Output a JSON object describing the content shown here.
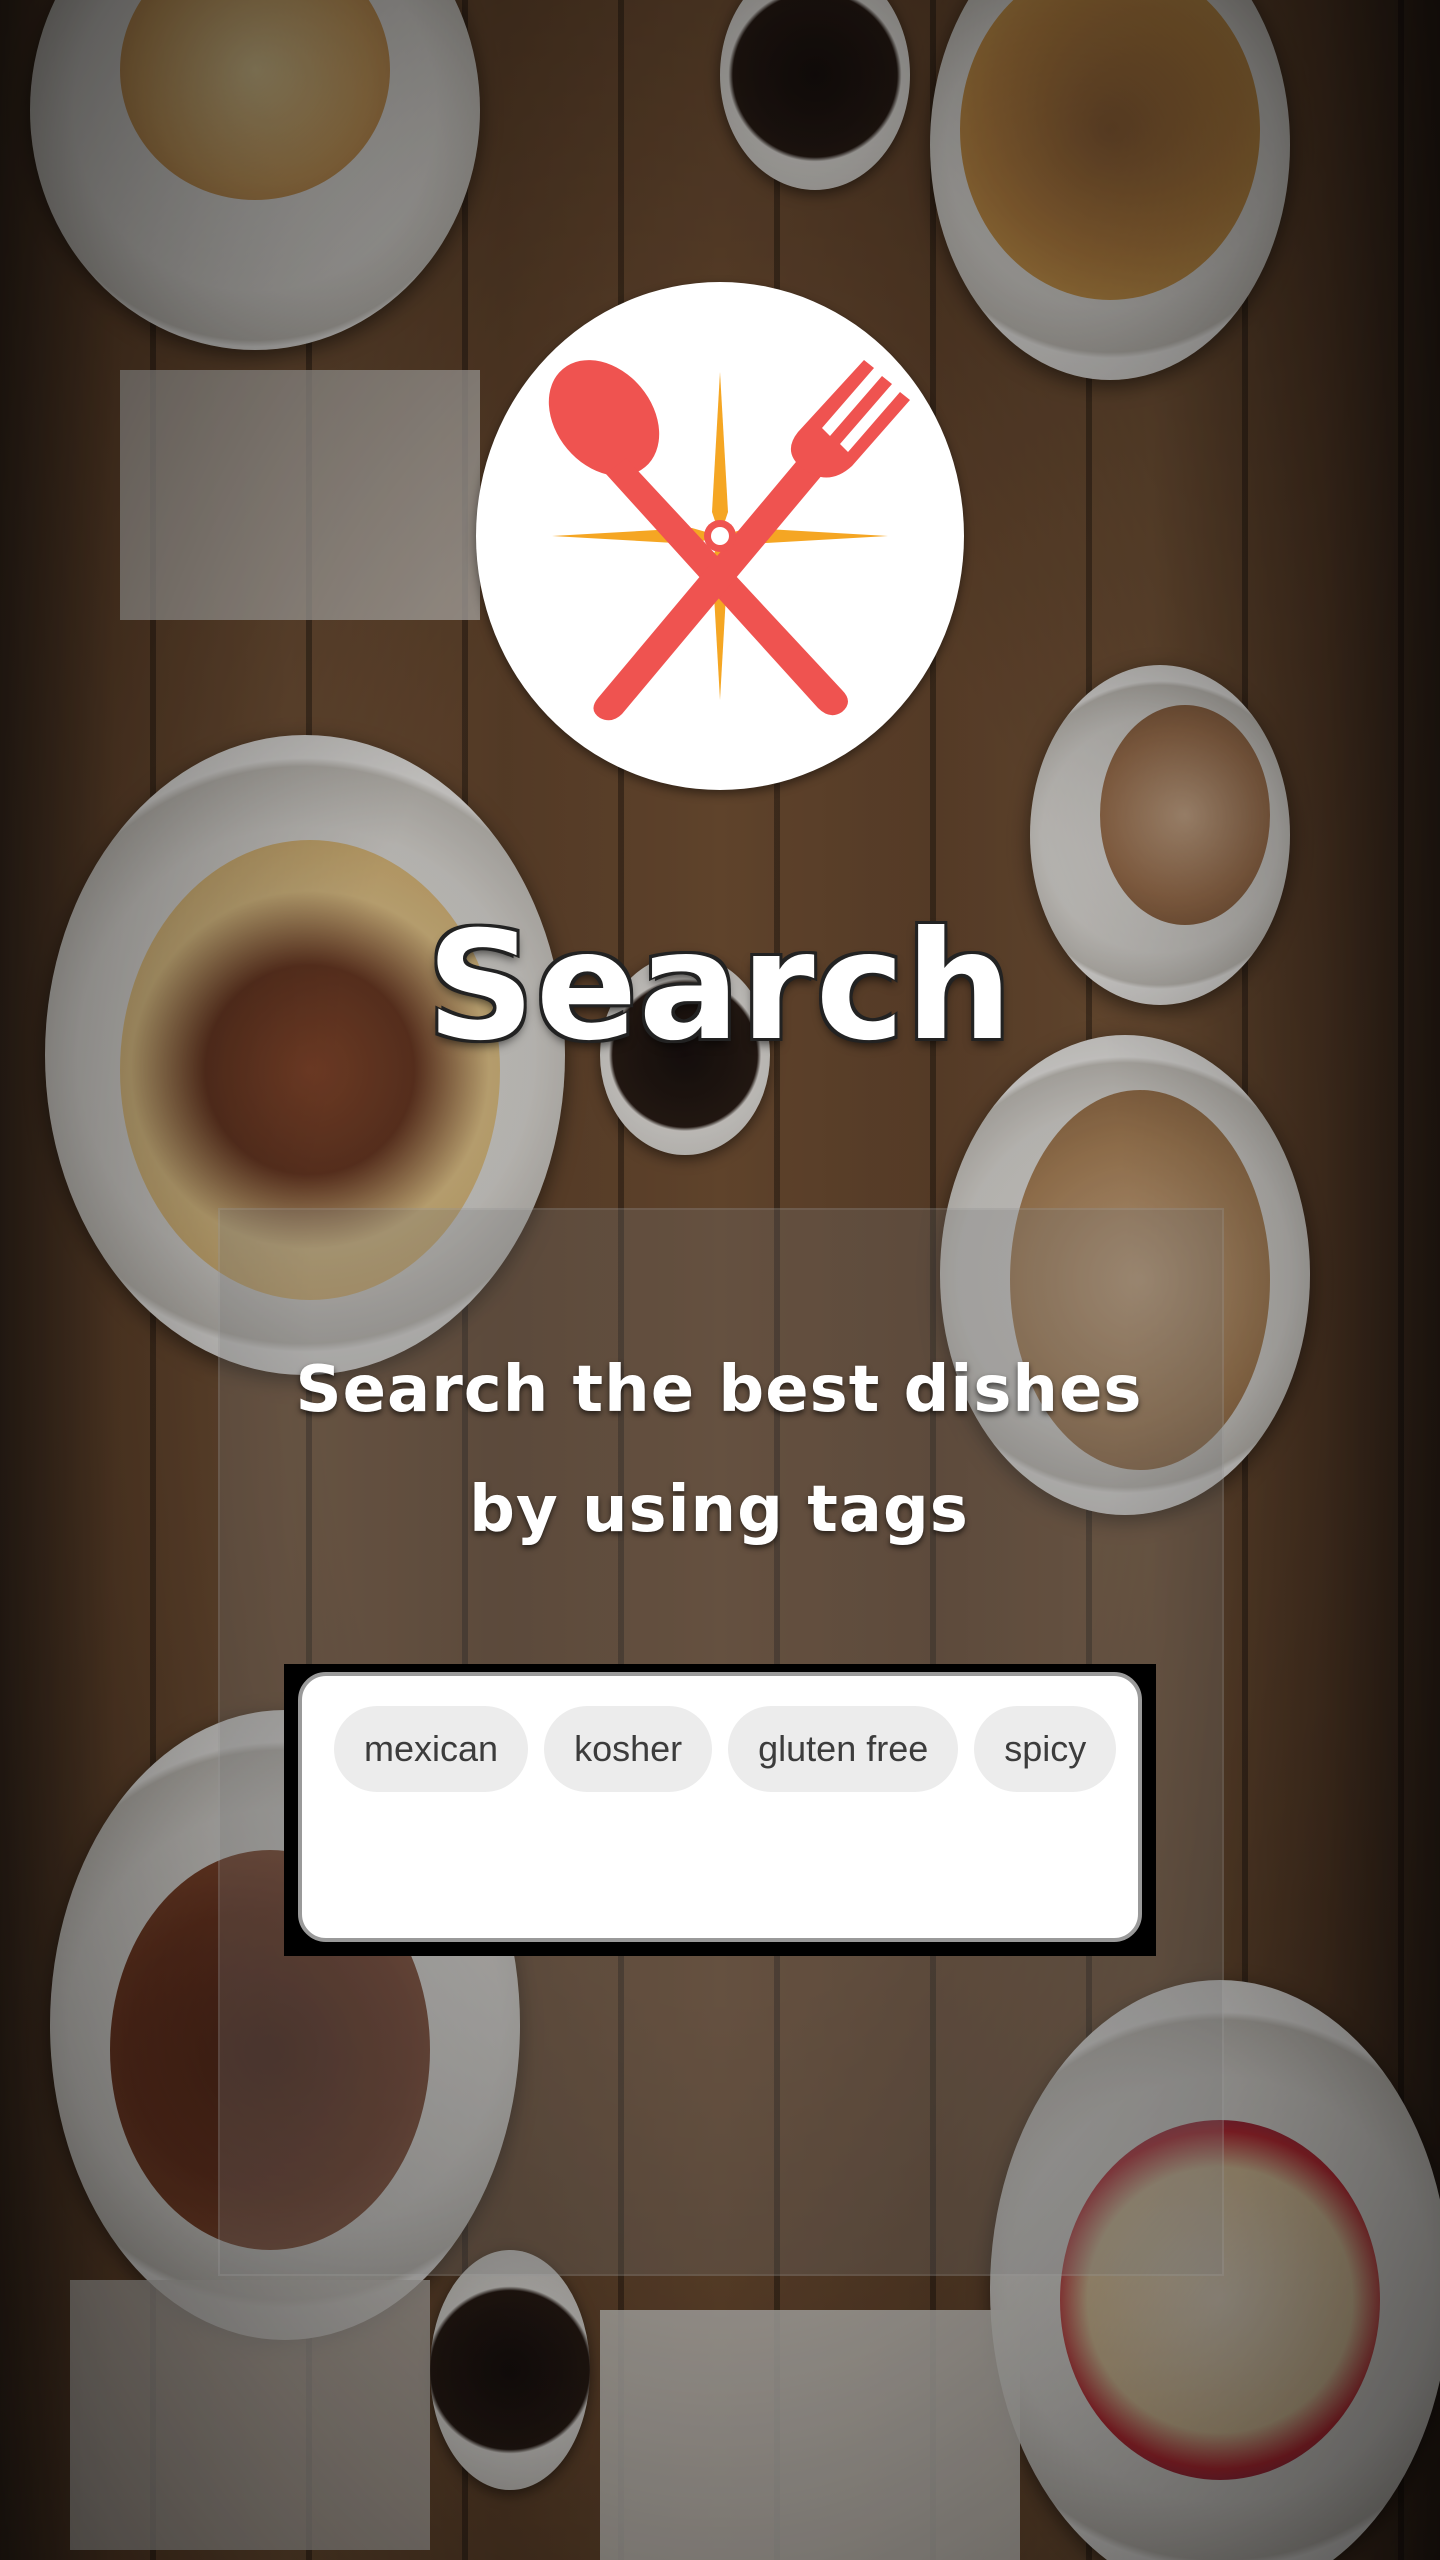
{
  "app": {
    "title": "Search",
    "subtitle_line1": "Search the best dishes",
    "subtitle_line2": "by using tags",
    "logo_icon": "crossed-spoon-fork-icon",
    "accent_color": "#ef5350",
    "star_color": "#f5a623"
  },
  "tags": {
    "items": [
      {
        "label": "mexican"
      },
      {
        "label": "kosher"
      },
      {
        "label": "gluten free"
      },
      {
        "label": "spicy"
      }
    ]
  }
}
